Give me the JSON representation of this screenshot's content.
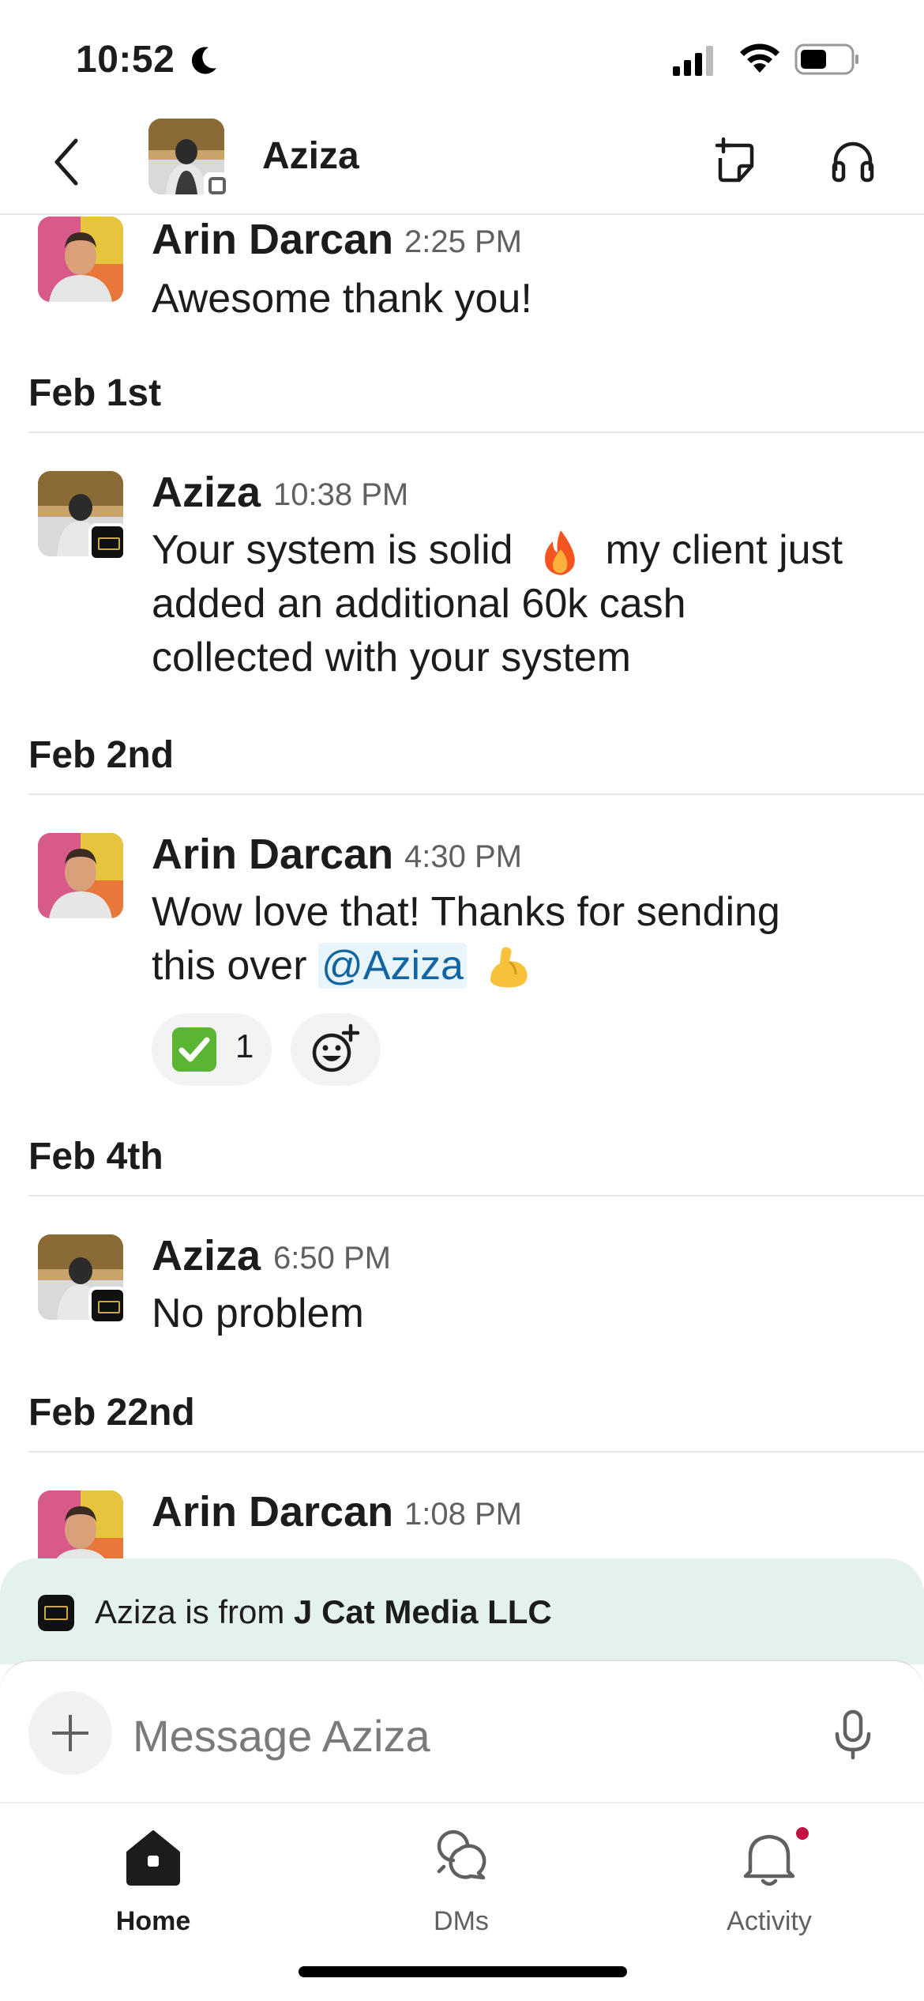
{
  "status_bar": {
    "time": "10:52"
  },
  "header": {
    "title": "Aziza"
  },
  "messages": [
    {
      "author": "Arin Darcan",
      "time": "2:25 PM",
      "text": "Awesome thank you!"
    },
    {
      "date": "Feb 1st",
      "author": "Aziza",
      "time": "10:38 PM",
      "line1_a": "Your system is solid",
      "line1_b": "my client just",
      "line2": "added an additional 60k cash",
      "line3": "collected  with your system"
    },
    {
      "date": "Feb 2nd",
      "author": "Arin Darcan",
      "time": "4:30 PM",
      "line1": "Wow love that! Thanks for sending",
      "line2_a": "this over",
      "mention": "@Aziza",
      "reaction_count": "1"
    },
    {
      "date": "Feb 4th",
      "author": "Aziza",
      "time": "6:50 PM",
      "text": "No problem"
    },
    {
      "date": "Feb 22nd",
      "author": "Arin Darcan",
      "time": "1:08 PM"
    }
  ],
  "org_banner": {
    "prefix": "Aziza is from",
    "org": "J Cat Media LLC"
  },
  "composer": {
    "placeholder": "Message Aziza"
  },
  "tabs": [
    {
      "label": "Home",
      "icon": "home-icon",
      "active": true
    },
    {
      "label": "DMs",
      "icon": "dms-icon"
    },
    {
      "label": "Activity",
      "icon": "bell-icon"
    }
  ],
  "colors": {
    "mention": "#1264a3",
    "banner": "#e3f1ef",
    "badge": "#c01343"
  }
}
